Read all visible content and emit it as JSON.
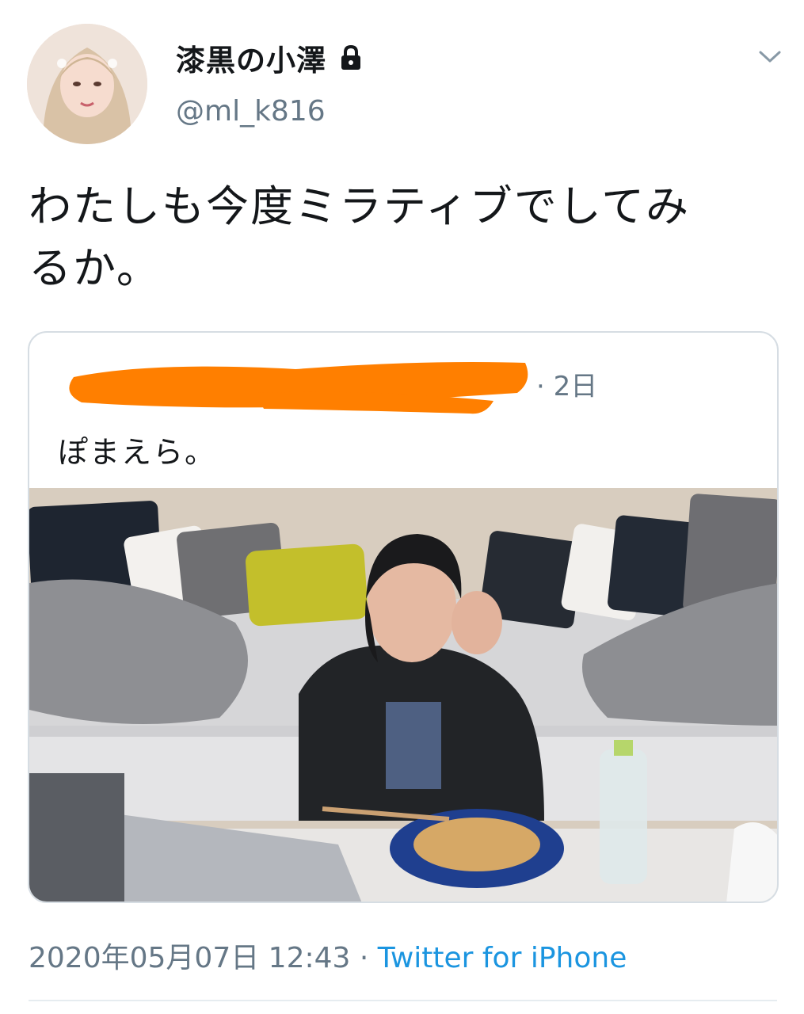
{
  "tweet": {
    "display_name": "漆黒の小澤",
    "handle": "@ml_k816",
    "text_line1": "わたしも今度ミラティブでしてみ",
    "text_line2": "るか。",
    "protected_icon": "lock-icon",
    "menu_icon": "chevron-down-icon"
  },
  "quoted_tweet": {
    "time": "· 2日",
    "text": "ぽまえら。",
    "redaction_color": "#ff7f00"
  },
  "footer": {
    "timestamp": "2020年05月07日 12:43",
    "separator": " · ",
    "source": "Twitter for iPhone"
  },
  "colors": {
    "link": "#1b95e0",
    "secondary_text": "#657786",
    "border": "#d6dde3"
  }
}
